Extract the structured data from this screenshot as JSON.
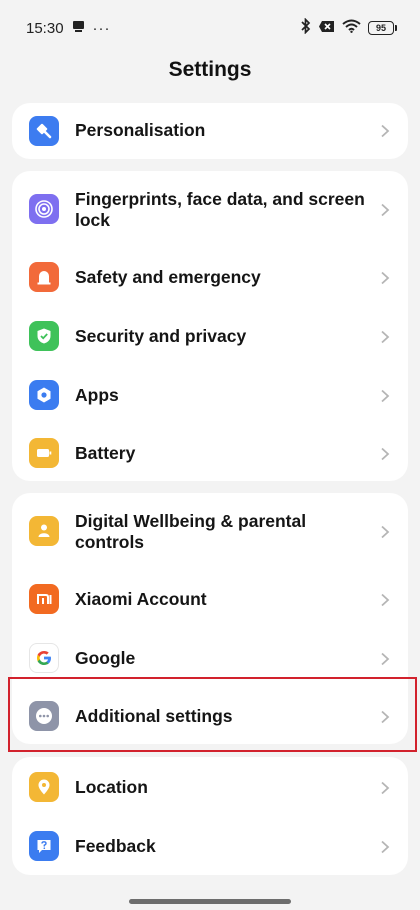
{
  "status_bar": {
    "time": "15:30",
    "dots": "···",
    "battery": "95",
    "icons": [
      "notification-card-icon",
      "bluetooth-icon",
      "no-sim-icon",
      "wifi-icon",
      "battery-icon"
    ]
  },
  "header": {
    "title": "Settings"
  },
  "sections": [
    {
      "items": [
        {
          "label": "Personalisation",
          "icon": "paint-brush-icon",
          "color": "#3d7cf0"
        }
      ]
    },
    {
      "items": [
        {
          "label": "Fingerprints, face data, and screen lock",
          "icon": "fingerprint-icon",
          "color": "#7e6ff0"
        },
        {
          "label": "Safety and emergency",
          "icon": "siren-icon",
          "color": "#f26a3a"
        },
        {
          "label": "Security and privacy",
          "icon": "shield-check-icon",
          "color": "#3fc25a"
        },
        {
          "label": "Apps",
          "icon": "apps-hexagon-icon",
          "color": "#3b7cf0"
        },
        {
          "label": "Battery",
          "icon": "battery-icon",
          "color": "#f3b735"
        }
      ]
    },
    {
      "items": [
        {
          "label": "Digital Wellbeing & parental controls",
          "icon": "wellbeing-icon",
          "color": "#f3b735"
        },
        {
          "label": "Xiaomi Account",
          "icon": "mi-logo-icon",
          "color": "#f26a21"
        },
        {
          "label": "Google",
          "icon": "google-g-icon",
          "color": "#ffffff"
        },
        {
          "label": "Additional settings",
          "icon": "more-dots-icon",
          "color": "#8e94a8"
        }
      ]
    },
    {
      "items": [
        {
          "label": "Location",
          "icon": "location-pin-icon",
          "color": "#f3b735"
        },
        {
          "label": "Feedback",
          "icon": "feedback-icon",
          "color": "#3b7cf0"
        }
      ]
    }
  ],
  "highlight_color": "#d2222d"
}
